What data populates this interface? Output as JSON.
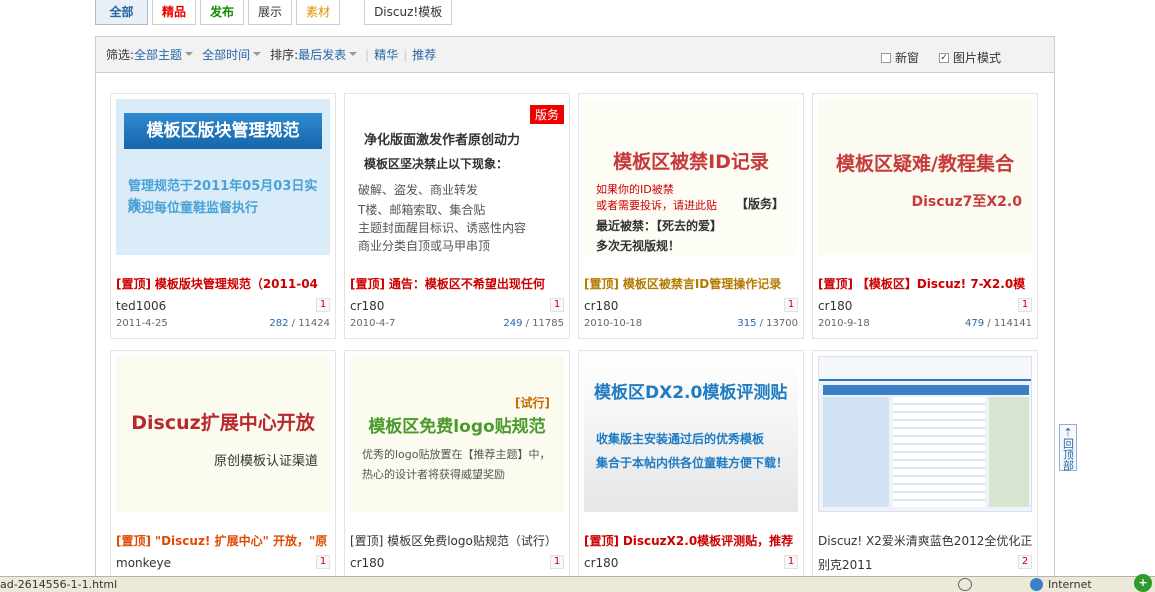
{
  "tabs": [
    "全部",
    "精品",
    "发布",
    "展示",
    "素材",
    "Discuz!模板"
  ],
  "filter": {
    "label": "筛选:",
    "theme": "全部主题",
    "time": "全部时间",
    "sort_label": "排序:",
    "sort": "最后发表",
    "digest": "精华",
    "recommend": "推荐",
    "new_window": "新窗",
    "image_mode": "图片模式",
    "image_mode_checked": true
  },
  "cards": [
    {
      "title_prefix": "[置顶]",
      "title": "模板版块管理规范（2011-04",
      "author": "ted1006",
      "page": "1",
      "date": "2011-4-25",
      "replies": "282",
      "views": "11424",
      "thumb": {
        "header": "模板区版块管理规范",
        "line1": "管理规范于2011年05月03日实施",
        "line2": "欢迎每位童鞋监督执行"
      }
    },
    {
      "title_prefix": "[置顶]",
      "title": "通告：模板区不希望出现任何",
      "author": "cr180",
      "page": "1",
      "date": "2010-4-7",
      "replies": "249",
      "views": "11785",
      "thumb": {
        "badge": "版务",
        "line1": "净化版面激发作者原创动力",
        "line2": "模板区坚决禁止以下现象：",
        "line3": "破解、盗发、商业转发",
        "line4": "T楼、邮箱索取、集合贴",
        "line5": "主题封面醒目标识、诱惑性内容",
        "line6": "商业分类自顶或马甲串顶"
      }
    },
    {
      "title_prefix": "[置顶]",
      "title": "模板区被禁言ID管理操作记录",
      "author": "cr180",
      "page": "1",
      "date": "2010-10-18",
      "replies": "315",
      "views": "13700",
      "thumb": {
        "header": "模板区被禁ID记录",
        "line1": "如果你的ID被禁",
        "line2": "或者需要投诉，请进此贴",
        "tag": "【版务】",
        "line3": "最近被禁：【死去的爱】",
        "line4": "多次无视版规！"
      }
    },
    {
      "title_prefix": "[置顶]",
      "title": "【模板区】Discuz! 7-X2.0模",
      "author": "cr180",
      "page": "1",
      "date": "2010-9-18",
      "replies": "479",
      "views": "114141",
      "thumb": {
        "header": "模板区疑难/教程集合",
        "line1": "Discuz7至X2.0"
      }
    },
    {
      "title_prefix": "[置顶]",
      "title": "\"Discuz! 扩展中心\" 开放，\"原",
      "author": "monkeye",
      "page": "1",
      "thumb": {
        "header": "Discuz扩展中心开放",
        "line1": "原创模板认证渠道"
      }
    },
    {
      "title_prefix": "[置顶]",
      "title": "模板区免费logo贴规范（试行）",
      "author": "cr180",
      "page": "1",
      "thumb": {
        "tag": "[试行]",
        "header": "模板区免费logo贴规范",
        "line1": "优秀的logo贴放置在【推荐主题】中，",
        "line2": "热心的设计者将获得威望奖励"
      }
    },
    {
      "title_prefix": "[置顶]",
      "title": "DiscuzX2.0模板评测贴，推荐",
      "author": "cr180",
      "page": "1",
      "thumb": {
        "header": "模板区DX2.0模板评测贴",
        "line1": "收集版主安装通过后的优秀模板",
        "line2": "集合于本帖内供各位童鞋方便下载！"
      }
    },
    {
      "title_prefix": "",
      "title": "Discuz! X2爱米清爽蓝色2012全优化正",
      "title2": "别克2011",
      "author": "",
      "page": "2"
    }
  ],
  "back_top": "回顶部",
  "status": {
    "url": "ad-2614556-1-1.html",
    "zone": "Internet"
  }
}
